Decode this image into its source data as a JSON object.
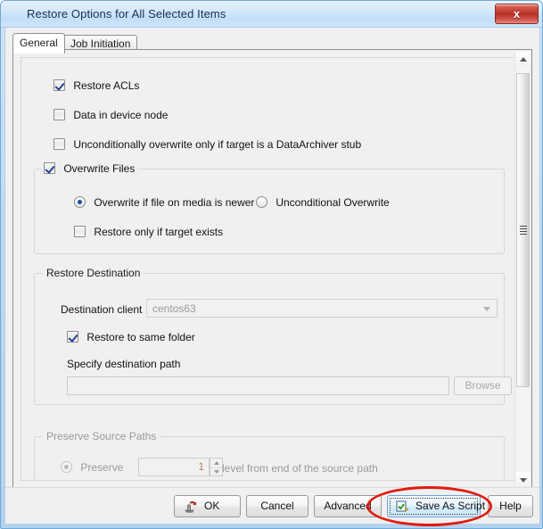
{
  "window": {
    "title": "Restore Options for All Selected Items",
    "close_label": "x",
    "close_icon": "close-icon",
    "accent_blue": "#b2d3f0",
    "annotation_color": "#e01b10"
  },
  "tabs": [
    {
      "label": "General",
      "active": true
    },
    {
      "label": "Job Initiation",
      "active": false
    }
  ],
  "general": {
    "checkboxes": [
      {
        "label": "Restore ACLs",
        "checked": true,
        "enabled": true
      },
      {
        "label": "Data in device node",
        "checked": false,
        "enabled": true
      },
      {
        "label": "Unconditionally overwrite only if target is a DataArchiver stub",
        "checked": false,
        "enabled": true
      }
    ],
    "overwrite_group": {
      "caption": "Overwrite Files",
      "caption_checked": true,
      "radios": [
        {
          "label": "Overwrite if file on media is newer",
          "selected": true
        },
        {
          "label": "Unconditional Overwrite",
          "selected": false
        }
      ],
      "restore_only_if_target_exists": {
        "label": "Restore only if target exists",
        "checked": false
      }
    },
    "restore_destination": {
      "caption": "Restore Destination",
      "destination_client_label": "Destination client",
      "destination_client_value": "centos63",
      "destination_client_enabled": false,
      "restore_same_folder": {
        "label": "Restore to same folder",
        "checked": true
      },
      "specify_path_label": "Specify destination path",
      "path_value": "",
      "path_enabled": false,
      "browse_label": "Browse",
      "browse_enabled": false
    },
    "preserve_source_paths": {
      "caption": "Preserve Source Paths",
      "enabled": false,
      "radio_label": "Preserve",
      "radio_selected": true,
      "level_value": "1",
      "suffix_label": "level from end of the source path"
    }
  },
  "buttons": {
    "ok": {
      "label": "OK",
      "icon": "restore-ok-icon"
    },
    "cancel": {
      "label": "Cancel"
    },
    "advanced": {
      "label": "Advanced"
    },
    "save_as_script": {
      "label": "Save As Script",
      "icon": "save-script-icon",
      "focused": true,
      "annotated": true
    },
    "help": {
      "label": "Help"
    }
  },
  "scrollbar": {
    "up_icon": "scroll-up-arrow-icon",
    "down_icon": "scroll-down-arrow-icon",
    "thumb_icon": "scrollbar-thumb-grip"
  }
}
